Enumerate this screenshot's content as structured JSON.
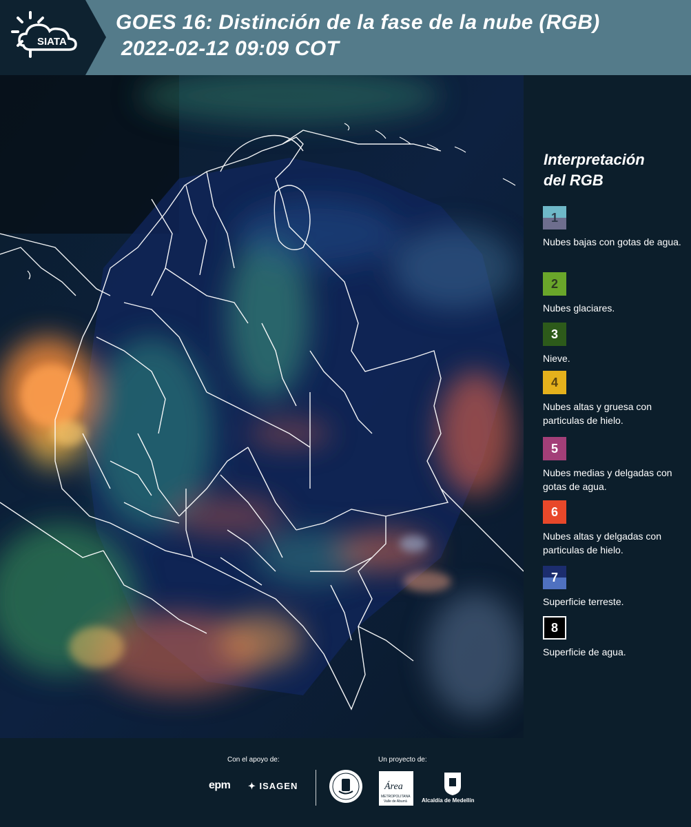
{
  "header": {
    "logo_text": "SIATA",
    "title_line1": "GOES 16: Distinción de la fase de la nube (RGB)",
    "title_line2": "2022-02-12 09:09 COT"
  },
  "map": {
    "type": "satellite-composite",
    "product": "Distinción de la fase de la nube (RGB)",
    "region": "Colombia and surroundings",
    "border_color": "#ffffff"
  },
  "legend": {
    "title_line1": "Interpretación",
    "title_line2": "del RGB",
    "items": [
      {
        "number": "1",
        "label": "Nubes bajas con gotas de agua.",
        "color_top": "#6fb8c8",
        "color_bottom": "#6e6e8e"
      },
      {
        "number": "2",
        "label": "Nubes glaciares.",
        "color": "#6aa62a"
      },
      {
        "number": "3",
        "label": "Nieve.",
        "color": "#2d5a1a"
      },
      {
        "number": "4",
        "label": "Nubes altas y gruesa con particulas de hielo.",
        "color": "#e5b11c"
      },
      {
        "number": "5",
        "label": "Nubes medias y delgadas con gotas de agua.",
        "color": "#a33f78"
      },
      {
        "number": "6",
        "label": "Nubes altas y delgadas con particulas de hielo.",
        "color": "#e8482a"
      },
      {
        "number": "7",
        "label": "Superficie terreste.",
        "color_top": "#1c2d6e",
        "color_bottom": "#4f71c0"
      },
      {
        "number": "8",
        "label": "Superficie de agua.",
        "color": "#000000"
      }
    ]
  },
  "footer": {
    "support_label": "Con el apoyo de:",
    "project_label": "Un proyecto de:",
    "epm": "epm",
    "isagen": "ISAGEN",
    "area_metro_word": "Área",
    "area_metro_line1": "METROPOLITANA",
    "area_metro_line2": "Valle de Aburrá",
    "alcaldia": "Alcaldía de Medellín"
  }
}
